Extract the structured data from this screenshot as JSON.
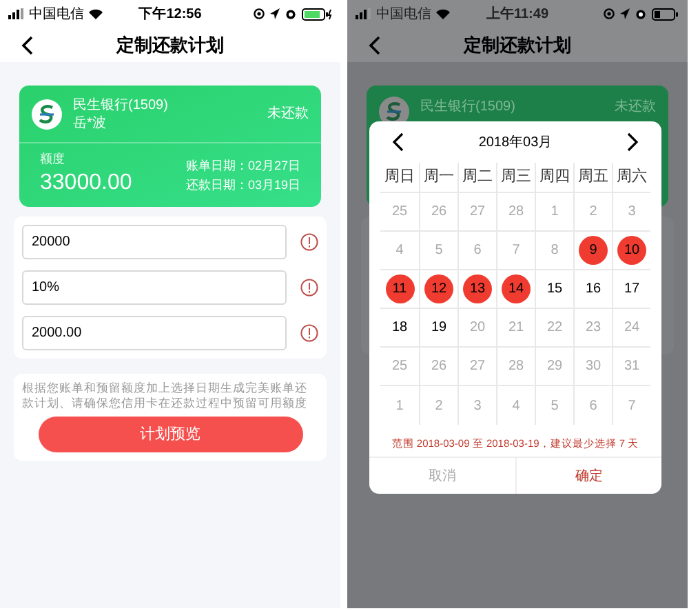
{
  "left_screen": {
    "status_bar": {
      "carrier": "中国电信",
      "time": "下午12:56"
    },
    "nav": {
      "title": "定制还款计划"
    },
    "card": {
      "bank": "民生银行(1509)",
      "holder": "岳*波",
      "status": "未还款",
      "limit_label": "额度",
      "limit": "33000.00",
      "bill_date": "账单日期：02月27日",
      "repay_date": "还款日期：03月19日"
    },
    "fields": [
      {
        "value": "20000"
      },
      {
        "value": "10%"
      },
      {
        "value": "2000.00"
      }
    ],
    "note": "根据您账单和预留额度加上选择日期生成完美账单还款计划、请确保您信用卡在还款过程中预留可用额度",
    "button": "计划预览"
  },
  "right_screen": {
    "status_bar": {
      "carrier": "中国电信",
      "time": "上午11:49"
    },
    "nav": {
      "title": "定制还款计划"
    },
    "card": {
      "bank": "民生银行(1509)",
      "status": "未还款"
    },
    "date_picker": {
      "month": "2018年03月",
      "weekdays": [
        "周日",
        "周一",
        "周二",
        "周三",
        "周四",
        "周五",
        "周六"
      ],
      "weeks": [
        [
          {
            "day": "25",
            "enabled": false,
            "selected": false
          },
          {
            "day": "26",
            "enabled": false,
            "selected": false
          },
          {
            "day": "27",
            "enabled": false,
            "selected": false
          },
          {
            "day": "28",
            "enabled": false,
            "selected": false
          },
          {
            "day": "1",
            "enabled": false,
            "selected": false
          },
          {
            "day": "2",
            "enabled": false,
            "selected": false
          },
          {
            "day": "3",
            "enabled": false,
            "selected": false
          }
        ],
        [
          {
            "day": "4",
            "enabled": false,
            "selected": false
          },
          {
            "day": "5",
            "enabled": false,
            "selected": false
          },
          {
            "day": "6",
            "enabled": false,
            "selected": false
          },
          {
            "day": "7",
            "enabled": false,
            "selected": false
          },
          {
            "day": "8",
            "enabled": false,
            "selected": false
          },
          {
            "day": "9",
            "enabled": true,
            "selected": true
          },
          {
            "day": "10",
            "enabled": true,
            "selected": true
          }
        ],
        [
          {
            "day": "11",
            "enabled": true,
            "selected": true
          },
          {
            "day": "12",
            "enabled": true,
            "selected": true
          },
          {
            "day": "13",
            "enabled": true,
            "selected": true
          },
          {
            "day": "14",
            "enabled": true,
            "selected": true
          },
          {
            "day": "15",
            "enabled": true,
            "selected": false
          },
          {
            "day": "16",
            "enabled": true,
            "selected": false
          },
          {
            "day": "17",
            "enabled": true,
            "selected": false
          }
        ],
        [
          {
            "day": "18",
            "enabled": true,
            "selected": false
          },
          {
            "day": "19",
            "enabled": true,
            "selected": false
          },
          {
            "day": "20",
            "enabled": false,
            "selected": false
          },
          {
            "day": "21",
            "enabled": false,
            "selected": false
          },
          {
            "day": "22",
            "enabled": false,
            "selected": false
          },
          {
            "day": "23",
            "enabled": false,
            "selected": false
          },
          {
            "day": "24",
            "enabled": false,
            "selected": false
          }
        ],
        [
          {
            "day": "25",
            "enabled": false,
            "selected": false
          },
          {
            "day": "26",
            "enabled": false,
            "selected": false
          },
          {
            "day": "27",
            "enabled": false,
            "selected": false
          },
          {
            "day": "28",
            "enabled": false,
            "selected": false
          },
          {
            "day": "29",
            "enabled": false,
            "selected": false
          },
          {
            "day": "30",
            "enabled": false,
            "selected": false
          },
          {
            "day": "31",
            "enabled": false,
            "selected": false
          }
        ],
        [
          {
            "day": "1",
            "enabled": false,
            "selected": false
          },
          {
            "day": "2",
            "enabled": false,
            "selected": false
          },
          {
            "day": "3",
            "enabled": false,
            "selected": false
          },
          {
            "day": "4",
            "enabled": false,
            "selected": false
          },
          {
            "day": "5",
            "enabled": false,
            "selected": false
          },
          {
            "day": "6",
            "enabled": false,
            "selected": false
          },
          {
            "day": "7",
            "enabled": false,
            "selected": false
          }
        ]
      ],
      "range_note": "范围 2018-03-09 至 2018-03-19，建议最少选择 7 天",
      "buttons": [
        {
          "label": "取消",
          "kind": "cancel"
        },
        {
          "label": "确定",
          "kind": "confirm"
        }
      ]
    }
  }
}
